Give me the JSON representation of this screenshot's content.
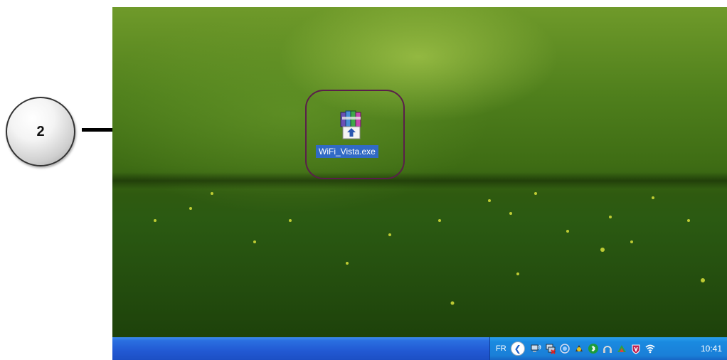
{
  "callout": {
    "step_number": "2"
  },
  "desktop": {
    "icons": [
      {
        "label": "WiFi_Vista.exe",
        "icon": "winrar-archive-icon"
      }
    ]
  },
  "taskbar": {
    "language": "FR",
    "clock": "10:41",
    "tray_icons": [
      "network-connection-icon",
      "wireless-disconnected-icon",
      "network-activity-icon",
      "security-icon",
      "bluetooth-icon",
      "headset-icon",
      "connection-icon",
      "antivirus-icon",
      "wifi-signal-icon"
    ]
  },
  "colors": {
    "taskbar": "#2259d3",
    "tray": "#1a8ae0",
    "selection": "#316ac5",
    "highlight_ring": "#5a1f4a"
  }
}
